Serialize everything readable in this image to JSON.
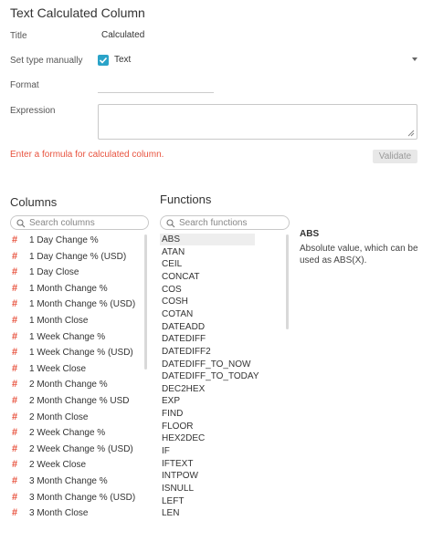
{
  "panel": {
    "title": "Text Calculated Column",
    "title_label": "Title",
    "title_value": "Calculated",
    "set_type_label": "Set type manually",
    "set_type_value": "Text",
    "format_label": "Format",
    "expression_label": "Expression",
    "error_text": "Enter a formula for calculated column.",
    "validate_label": "Validate"
  },
  "columns": {
    "heading": "Columns",
    "search_placeholder": "Search columns",
    "type_glyph": "#",
    "items": [
      "1 Day Change %",
      "1 Day Change % (USD)",
      "1 Day Close",
      "1 Month Change %",
      "1 Month Change % (USD)",
      "1 Month Close",
      "1 Week Change %",
      "1 Week Change % (USD)",
      "1 Week Close",
      "2 Month Change %",
      "2 Month Change % USD",
      "2 Month Close",
      "2 Week Change %",
      "2 Week Change % (USD)",
      "2 Week Close",
      "3 Month Change %",
      "3 Month Change % (USD)",
      "3 Month Close"
    ]
  },
  "functions": {
    "heading": "Functions",
    "search_placeholder": "Search functions",
    "selected": "ABS",
    "items": [
      "ABS",
      "ATAN",
      "CEIL",
      "CONCAT",
      "COS",
      "COSH",
      "COTAN",
      "DATEADD",
      "DATEDIFF",
      "DATEDIFF2",
      "DATEDIFF_TO_NOW",
      "DATEDIFF_TO_TODAY",
      "DEC2HEX",
      "EXP",
      "FIND",
      "FLOOR",
      "HEX2DEC",
      "IF",
      "IFTEXT",
      "INTPOW",
      "ISNULL",
      "LEFT",
      "LEN"
    ]
  },
  "description": {
    "title": "ABS",
    "text": "Absolute value, which can be used as ABS(X)."
  },
  "colors": {
    "accent": "#2aa3c8",
    "error": "#e8533f"
  }
}
